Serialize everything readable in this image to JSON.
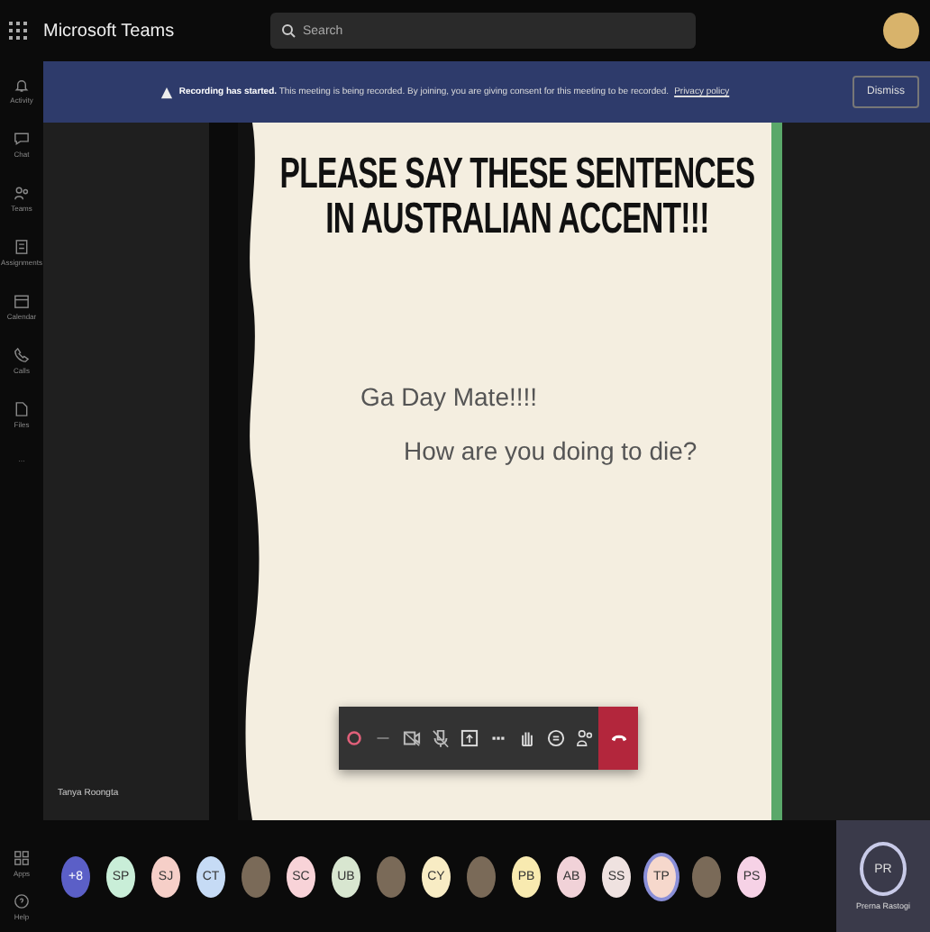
{
  "app": {
    "title": "Microsoft Teams"
  },
  "search": {
    "placeholder": "Search"
  },
  "rail": [
    {
      "label": "Activity",
      "kind": "bell"
    },
    {
      "label": "Chat",
      "kind": "chat"
    },
    {
      "label": "Teams",
      "kind": "teams"
    },
    {
      "label": "Assignments",
      "kind": "assignments"
    },
    {
      "label": "Calendar",
      "kind": "calendar"
    },
    {
      "label": "Calls",
      "kind": "calls"
    },
    {
      "label": "Files",
      "kind": "files"
    },
    {
      "label": "…",
      "kind": "more"
    }
  ],
  "rail_bottom": [
    {
      "label": "Apps",
      "kind": "apps"
    },
    {
      "label": "Help",
      "kind": "help"
    }
  ],
  "banner": {
    "text": "**Recording has started.** This meeting is being recorded. By joining, you are giving consent for this meeting to be recorded.",
    "link": "Privacy policy",
    "button": "Dismiss"
  },
  "participant_tile": {
    "name": "Tanya Roongta"
  },
  "slide": {
    "heading": "PLEASE SAY THESE SENTENCES IN AUSTRALIAN ACCENT!!!",
    "lines": [
      "Ga Day Mate!!!!",
      "How are you doing to die?"
    ]
  },
  "toolbar": [
    {
      "kind": "record"
    },
    {
      "kind": "dash"
    },
    {
      "kind": "camera"
    },
    {
      "kind": "mic"
    },
    {
      "kind": "share"
    },
    {
      "kind": "more"
    },
    {
      "kind": "hand"
    },
    {
      "kind": "chat"
    },
    {
      "kind": "people"
    },
    {
      "kind": "leave"
    }
  ],
  "participants": [
    {
      "kind": "initials",
      "initials": "+8",
      "color": "#5b5fc7",
      "speaking": false
    },
    {
      "kind": "initials",
      "initials": "SP",
      "color": "#c9eed8",
      "speaking": false
    },
    {
      "kind": "initials",
      "initials": "SJ",
      "color": "#f6cfc8",
      "speaking": false
    },
    {
      "kind": "initials",
      "initials": "CT",
      "color": "#c6dbf5",
      "speaking": false
    },
    {
      "kind": "photo",
      "speaking": false
    },
    {
      "kind": "initials",
      "initials": "SC",
      "color": "#f8d3d8",
      "speaking": false
    },
    {
      "kind": "initials",
      "initials": "UB",
      "color": "#d8e6d0",
      "speaking": false
    },
    {
      "kind": "photo",
      "speaking": false
    },
    {
      "kind": "initials",
      "initials": "CY",
      "color": "#f8ecc4",
      "speaking": false
    },
    {
      "kind": "photo",
      "speaking": false
    },
    {
      "kind": "initials",
      "initials": "PB",
      "color": "#f8eab0",
      "speaking": false
    },
    {
      "kind": "initials",
      "initials": "AB",
      "color": "#f1d2d8",
      "speaking": false
    },
    {
      "kind": "initials",
      "initials": "SS",
      "color": "#efe2e0",
      "speaking": false
    },
    {
      "kind": "initials",
      "initials": "TP",
      "color": "#f6d8cc",
      "speaking": true
    },
    {
      "kind": "photo",
      "speaking": false
    },
    {
      "kind": "initials",
      "initials": "PS",
      "color": "#f6d2e6",
      "speaking": false
    }
  ],
  "self_tile": {
    "initials": "PR",
    "name": "Prerna Rastogi"
  }
}
